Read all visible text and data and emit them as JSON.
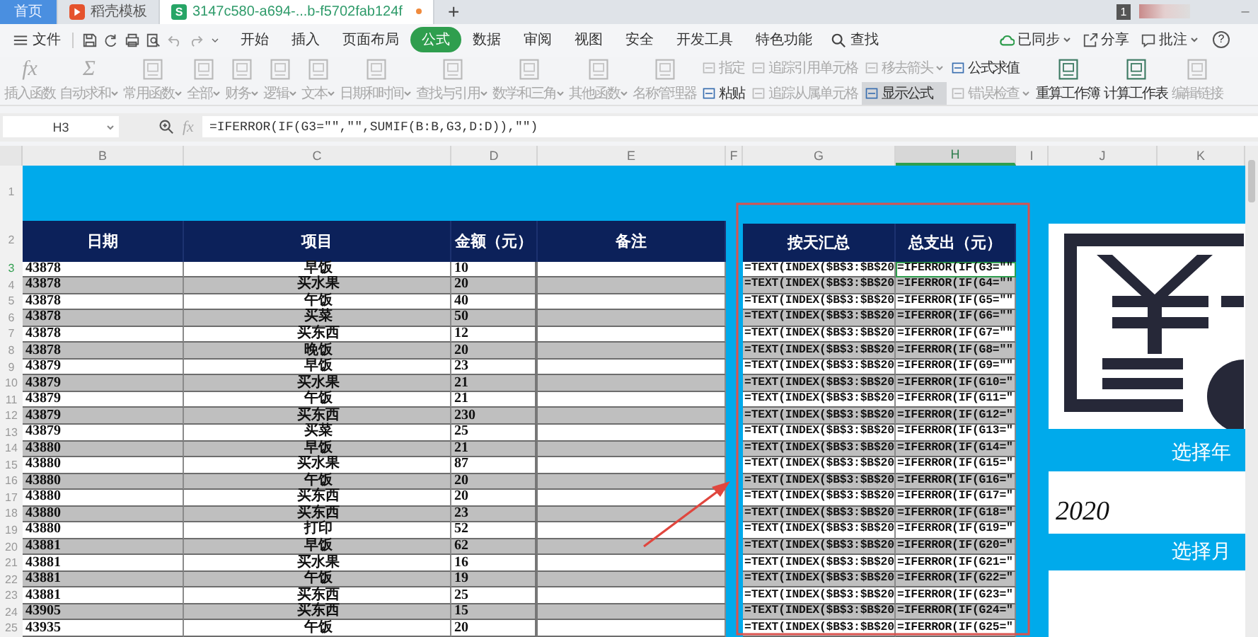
{
  "tabs": [
    {
      "kind": "home",
      "label": "首页",
      "selected": false
    },
    {
      "kind": "doc",
      "label": "稻壳模板",
      "selected": false
    },
    {
      "kind": "sheet",
      "icon_letter": "S",
      "label": "3147c580-a694-...b-f5702fab124f",
      "selected": true
    }
  ],
  "new_tab": "+",
  "notification_count": "1",
  "minimize": "–",
  "menu": {
    "file": "文件",
    "tabs": [
      {
        "label": "开始",
        "selected": false
      },
      {
        "label": "插入",
        "selected": false
      },
      {
        "label": "页面布局",
        "selected": false
      },
      {
        "label": "公式",
        "selected": true
      },
      {
        "label": "数据",
        "selected": false
      },
      {
        "label": "审阅",
        "selected": false
      },
      {
        "label": "视图",
        "selected": false
      },
      {
        "label": "安全",
        "selected": false
      },
      {
        "label": "开发工具",
        "selected": false
      },
      {
        "label": "特色功能",
        "selected": false
      }
    ],
    "search": "查找",
    "right": [
      {
        "label": "已同步",
        "dropdown": true
      },
      {
        "label": "分享",
        "dropdown": false
      },
      {
        "label": "批注",
        "dropdown": true
      }
    ],
    "help": "?"
  },
  "ribbon": [
    {
      "kind": "large",
      "glyph": "fx",
      "label": "插入函数",
      "disabled": true,
      "dropdown": false
    },
    {
      "kind": "large",
      "glyph": "Σ",
      "label": "自动求和",
      "disabled": true,
      "dropdown": true
    },
    {
      "kind": "large",
      "label": "常用函数",
      "disabled": true,
      "dropdown": true
    },
    {
      "kind": "large",
      "label": "全部",
      "disabled": true,
      "dropdown": true
    },
    {
      "kind": "large",
      "label": "财务",
      "disabled": true,
      "dropdown": true
    },
    {
      "kind": "large",
      "label": "逻辑",
      "disabled": true,
      "dropdown": true
    },
    {
      "kind": "large",
      "label": "文本",
      "disabled": true,
      "dropdown": true
    },
    {
      "kind": "large",
      "label": "日期和时间",
      "disabled": true,
      "dropdown": true
    },
    {
      "kind": "large",
      "label": "查找与引用",
      "disabled": true,
      "dropdown": true
    },
    {
      "kind": "large",
      "label": "数学和三角",
      "disabled": true,
      "dropdown": true
    },
    {
      "kind": "large",
      "label": "其他函数",
      "disabled": true,
      "dropdown": true
    },
    {
      "kind": "large",
      "label": "名称管理器",
      "disabled": true,
      "dropdown": false
    },
    {
      "kind": "stack",
      "items": [
        {
          "label": "指定",
          "disabled": true,
          "selected": false,
          "dropdown": false
        },
        {
          "label": "粘贴",
          "disabled": false,
          "selected": false,
          "dropdown": false
        }
      ]
    },
    {
      "kind": "stack",
      "items": [
        {
          "label": "追踪引用单元格",
          "disabled": true,
          "selected": false,
          "dropdown": false
        },
        {
          "label": "追踪从属单元格",
          "disabled": true,
          "selected": false,
          "dropdown": false
        }
      ]
    },
    {
      "kind": "stack",
      "items": [
        {
          "label": "移去箭头",
          "disabled": true,
          "selected": false,
          "dropdown": true
        },
        {
          "label": "显示公式",
          "disabled": false,
          "selected": true,
          "dropdown": false
        }
      ]
    },
    {
      "kind": "stack",
      "items": [
        {
          "label": "公式求值",
          "disabled": false,
          "selected": false,
          "dropdown": false
        },
        {
          "label": "错误检查",
          "disabled": true,
          "selected": false,
          "dropdown": true
        }
      ]
    },
    {
      "kind": "large",
      "label": "重算工作簿",
      "disabled": false,
      "dropdown": false
    },
    {
      "kind": "large",
      "label": "计算工作表",
      "disabled": false,
      "dropdown": false
    },
    {
      "kind": "large",
      "label": "编辑链接",
      "disabled": true,
      "dropdown": false
    }
  ],
  "formula_bar": {
    "name_box": "H3",
    "fx": "fx",
    "formula": "=IFERROR(IF(G3=\"\",\"\",SUMIF(B:B,G3,D:D)),\"\")"
  },
  "sheet": {
    "columns": [
      {
        "label": "B",
        "selected": false
      },
      {
        "label": "C",
        "selected": false
      },
      {
        "label": "D",
        "selected": false
      },
      {
        "label": "E",
        "selected": false
      },
      {
        "label": "F",
        "selected": false
      },
      {
        "label": "G",
        "selected": false
      },
      {
        "label": "H",
        "selected": true
      },
      {
        "label": "I",
        "selected": false
      },
      {
        "label": "J",
        "selected": false
      },
      {
        "label": "K",
        "selected": false
      }
    ],
    "banner_rows": [
      "1",
      "2"
    ],
    "headers": [
      "日期",
      "项目",
      "金额（元）",
      "备注"
    ],
    "summary_headers": [
      "按天汇总",
      "总支出（元）"
    ],
    "rows": [
      {
        "number": "3",
        "date": "43878",
        "item": "早饭",
        "amount": "10",
        "summary": "=TEXT(INDEX($B$3:$B$20",
        "total": "=IFERROR(IF(G3=\"\"",
        "selected": true
      },
      {
        "number": "4",
        "date": "43878",
        "item": "买水果",
        "amount": "20",
        "summary": "=TEXT(INDEX($B$3:$B$20",
        "total": "=IFERROR(IF(G4=\"\"",
        "selected": false
      },
      {
        "number": "5",
        "date": "43878",
        "item": "午饭",
        "amount": "40",
        "summary": "=TEXT(INDEX($B$3:$B$20",
        "total": "=IFERROR(IF(G5=\"\"",
        "selected": false
      },
      {
        "number": "6",
        "date": "43878",
        "item": "买菜",
        "amount": "50",
        "summary": "=TEXT(INDEX($B$3:$B$20",
        "total": "=IFERROR(IF(G6=\"\"",
        "selected": false
      },
      {
        "number": "7",
        "date": "43878",
        "item": "买东西",
        "amount": "12",
        "summary": "=TEXT(INDEX($B$3:$B$20",
        "total": "=IFERROR(IF(G7=\"\"",
        "selected": false
      },
      {
        "number": "8",
        "date": "43878",
        "item": "晚饭",
        "amount": "20",
        "summary": "=TEXT(INDEX($B$3:$B$20",
        "total": "=IFERROR(IF(G8=\"\"",
        "selected": false
      },
      {
        "number": "9",
        "date": "43879",
        "item": "早饭",
        "amount": "23",
        "summary": "=TEXT(INDEX($B$3:$B$20",
        "total": "=IFERROR(IF(G9=\"\"",
        "selected": false
      },
      {
        "number": "10",
        "date": "43879",
        "item": "买水果",
        "amount": "21",
        "summary": "=TEXT(INDEX($B$3:$B$20",
        "total": "=IFERROR(IF(G10=\"",
        "selected": false
      },
      {
        "number": "11",
        "date": "43879",
        "item": "午饭",
        "amount": "21",
        "summary": "=TEXT(INDEX($B$3:$B$20",
        "total": "=IFERROR(IF(G11=\"",
        "selected": false
      },
      {
        "number": "12",
        "date": "43879",
        "item": "买东西",
        "amount": "230",
        "summary": "=TEXT(INDEX($B$3:$B$20",
        "total": "=IFERROR(IF(G12=\"",
        "selected": false
      },
      {
        "number": "13",
        "date": "43879",
        "item": "买菜",
        "amount": "25",
        "summary": "=TEXT(INDEX($B$3:$B$20",
        "total": "=IFERROR(IF(G13=\"",
        "selected": false
      },
      {
        "number": "14",
        "date": "43880",
        "item": "早饭",
        "amount": "21",
        "summary": "=TEXT(INDEX($B$3:$B$20",
        "total": "=IFERROR(IF(G14=\"",
        "selected": false
      },
      {
        "number": "15",
        "date": "43880",
        "item": "买水果",
        "amount": "87",
        "summary": "=TEXT(INDEX($B$3:$B$20",
        "total": "=IFERROR(IF(G15=\"",
        "selected": false
      },
      {
        "number": "16",
        "date": "43880",
        "item": "午饭",
        "amount": "20",
        "summary": "=TEXT(INDEX($B$3:$B$20",
        "total": "=IFERROR(IF(G16=\"",
        "selected": false
      },
      {
        "number": "17",
        "date": "43880",
        "item": "买东西",
        "amount": "20",
        "summary": "=TEXT(INDEX($B$3:$B$20",
        "total": "=IFERROR(IF(G17=\"",
        "selected": false
      },
      {
        "number": "18",
        "date": "43880",
        "item": "买东西",
        "amount": "23",
        "summary": "=TEXT(INDEX($B$3:$B$20",
        "total": "=IFERROR(IF(G18=\"",
        "selected": false
      },
      {
        "number": "19",
        "date": "43880",
        "item": "打印",
        "amount": "52",
        "summary": "=TEXT(INDEX($B$3:$B$20",
        "total": "=IFERROR(IF(G19=\"",
        "selected": false
      },
      {
        "number": "20",
        "date": "43881",
        "item": "早饭",
        "amount": "62",
        "summary": "=TEXT(INDEX($B$3:$B$20",
        "total": "=IFERROR(IF(G20=\"",
        "selected": false
      },
      {
        "number": "21",
        "date": "43881",
        "item": "买水果",
        "amount": "16",
        "summary": "=TEXT(INDEX($B$3:$B$20",
        "total": "=IFERROR(IF(G21=\"",
        "selected": false
      },
      {
        "number": "22",
        "date": "43881",
        "item": "午饭",
        "amount": "19",
        "summary": "=TEXT(INDEX($B$3:$B$20",
        "total": "=IFERROR(IF(G22=\"",
        "selected": false
      },
      {
        "number": "23",
        "date": "43881",
        "item": "买东西",
        "amount": "25",
        "summary": "=TEXT(INDEX($B$3:$B$20",
        "total": "=IFERROR(IF(G23=\"",
        "selected": false
      },
      {
        "number": "24",
        "date": "43905",
        "item": "买东西",
        "amount": "15",
        "summary": "=TEXT(INDEX($B$3:$B$20",
        "total": "=IFERROR(IF(G24=\"",
        "selected": false
      },
      {
        "number": "25",
        "date": "43935",
        "item": "午饭",
        "amount": "20",
        "summary": "=TEXT(INDEX($B$3:$B$20",
        "total": "=IFERROR(IF(G25=\"",
        "selected": false
      }
    ]
  },
  "panel": {
    "year_label": "选择年",
    "year": "2020",
    "month_label": "选择月"
  }
}
